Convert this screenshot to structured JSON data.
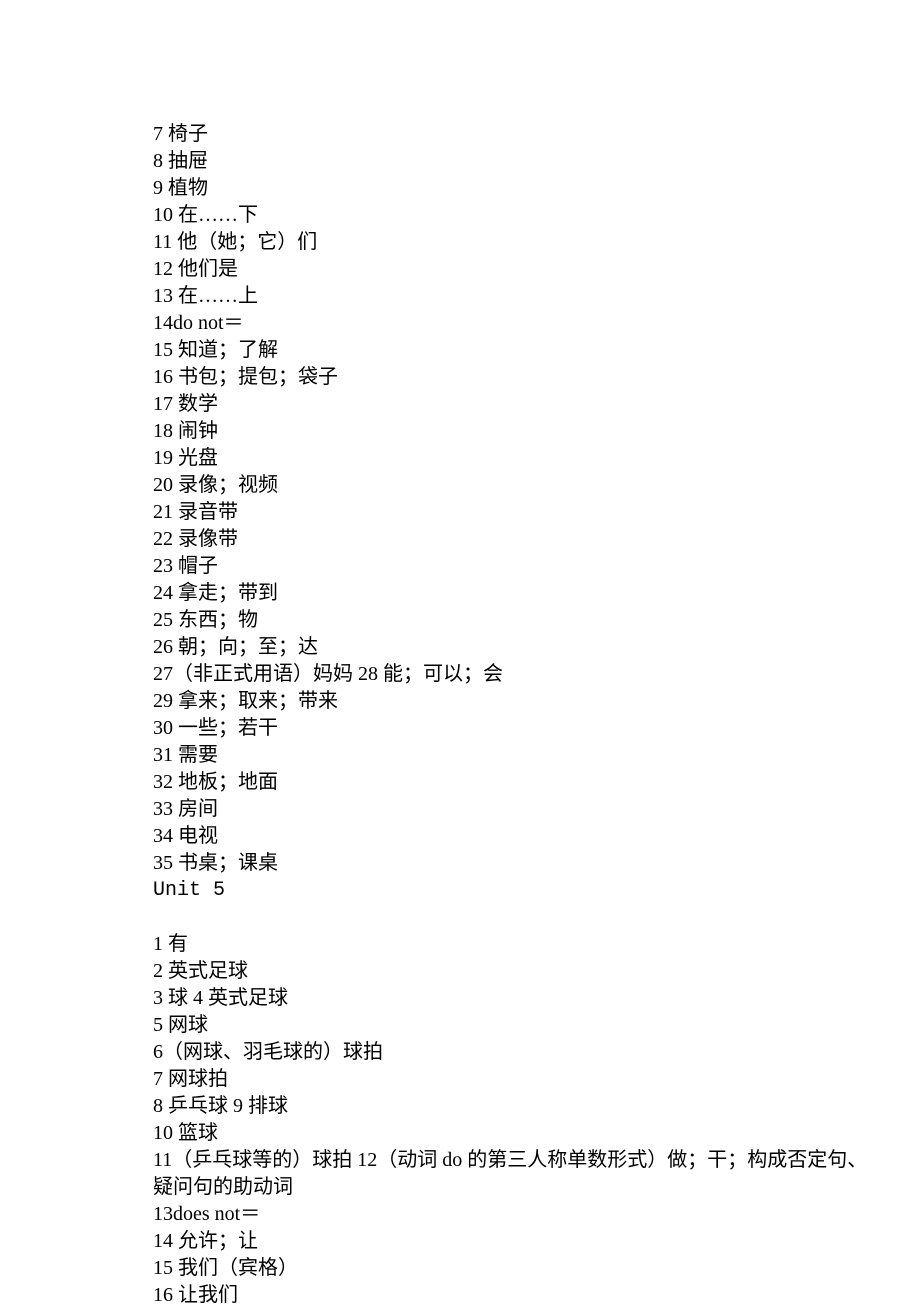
{
  "lines": [
    {
      "text": "7 椅子"
    },
    {
      "text": "8 抽屉"
    },
    {
      "text": "9 植物"
    },
    {
      "text": "10 在……下"
    },
    {
      "text": "11 他（她；它）们"
    },
    {
      "text": "12 他们是"
    },
    {
      "text": "13 在……上"
    },
    {
      "text": "14do not＝",
      "mono_prefix": true
    },
    {
      "text": "15 知道；了解"
    },
    {
      "text": "16 书包；提包；袋子"
    },
    {
      "text": "17 数学"
    },
    {
      "text": "18 闹钟"
    },
    {
      "text": "19 光盘"
    },
    {
      "text": "20 录像；视频"
    },
    {
      "text": "21 录音带"
    },
    {
      "text": "22 录像带"
    },
    {
      "text": "23 帽子"
    },
    {
      "text": "24 拿走；带到"
    },
    {
      "text": "25 东西；物"
    },
    {
      "text": "26 朝；向；至；达"
    },
    {
      "text": "27（非正式用语）妈妈 28 能；可以；会"
    },
    {
      "text": "29 拿来；取来；带来"
    },
    {
      "text": "30 一些；若干"
    },
    {
      "text": "31 需要"
    },
    {
      "text": "32 地板；地面"
    },
    {
      "text": "33 房间"
    },
    {
      "text": "34 电视"
    },
    {
      "text": "35 书桌；课桌"
    },
    {
      "text": "Unit 5",
      "mono": true
    },
    {
      "blank": true
    },
    {
      "text": "1 有"
    },
    {
      "text": "2 英式足球"
    },
    {
      "text": "3 球 4 英式足球"
    },
    {
      "text": "5 网球"
    },
    {
      "text": "6（网球、羽毛球的）球拍"
    },
    {
      "text": "7 网球拍"
    },
    {
      "text": "8 乒乓球 9 排球"
    },
    {
      "text": "10 篮球"
    },
    {
      "text": "11（乒乓球等的）球拍 12（动词 do 的第三人称单数形式）做；干；构成否定句、"
    },
    {
      "text": "疑问句的助动词"
    },
    {
      "text": "13does not＝",
      "mono_prefix": true
    },
    {
      "text": "14 允许；让"
    },
    {
      "text": "15 我们（宾格）"
    },
    {
      "text": "16 让我们"
    }
  ]
}
